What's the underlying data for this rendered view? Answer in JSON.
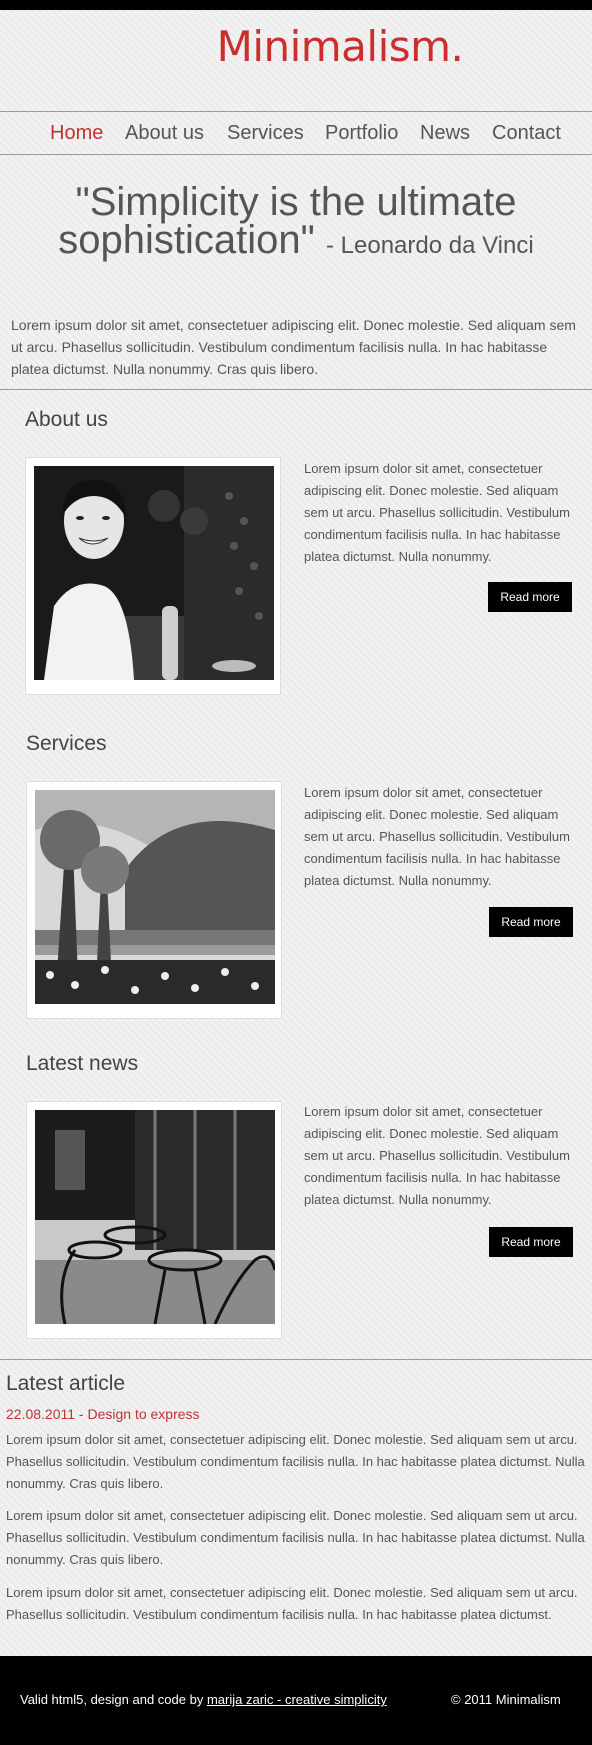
{
  "site": {
    "logo": "Minimalism."
  },
  "nav": [
    "Home",
    "About us",
    "Services",
    "Portfolio",
    "News",
    "Contact"
  ],
  "hero": {
    "quote": "\"Simplicity is the ultimate sophistication\"",
    "author": "- Leonardo da Vinci"
  },
  "intro": "Lorem ipsum dolor sit amet, consectetuer adipiscing elit. Donec molestie. Sed aliquam sem ut arcu. Phasellus sollicitudin. Vestibulum condimentum facilisis nulla. In hac habitasse platea dictumst. Nulla nonummy. Cras quis libero.",
  "sections": [
    {
      "title": "About us",
      "text": "Lorem ipsum dolor sit amet, consectetuer adipiscing elit. Donec molestie. Sed aliquam sem ut arcu. Phasellus sollicitudin. Vestibulum condimentum facilisis nulla. In hac habitasse platea dictumst. Nulla nonummy.",
      "button": "Read more"
    },
    {
      "title": "Services",
      "text": "Lorem ipsum dolor sit amet, consectetuer adipiscing elit. Donec molestie. Sed aliquam sem ut arcu. Phasellus sollicitudin. Vestibulum condimentum facilisis nulla. In hac habitasse platea dictumst. Nulla nonummy.",
      "button": "Read more"
    },
    {
      "title": "Latest news",
      "text": "Lorem ipsum dolor sit amet, consectetuer adipiscing elit. Donec molestie. Sed aliquam sem ut arcu. Phasellus sollicitudin. Vestibulum condimentum facilisis nulla. In hac habitasse platea dictumst. Nulla nonummy.",
      "button": "Read more"
    }
  ],
  "article": {
    "title": "Latest article",
    "date_line": "22.08.2011 - Design to express",
    "paragraphs": [
      "Lorem ipsum dolor sit amet, consectetuer adipiscing elit. Donec molestie. Sed aliquam sem ut arcu. Phasellus sollicitudin. Vestibulum condimentum facilisis nulla. In hac habitasse platea dictumst. Nulla nonummy. Cras quis libero.",
      "Lorem ipsum dolor sit amet, consectetuer adipiscing elit. Donec molestie. Sed aliquam sem ut arcu. Phasellus sollicitudin. Vestibulum condimentum facilisis nulla. In hac habitasse platea dictumst. Nulla nonummy. Cras quis libero.",
      "Lorem ipsum dolor sit amet, consectetuer adipiscing elit. Donec molestie. Sed aliquam sem ut arcu. Phasellus sollicitudin. Vestibulum condimentum facilisis nulla. In hac habitasse platea dictumst."
    ]
  },
  "footer": {
    "credit_prefix": "Valid html5, design and code by",
    "credit_link": "marija zaric - creative simplicity",
    "copyright": "© 2011 Minimalism"
  },
  "colors": {
    "accent": "#c23131",
    "logo": "#cc2d2d",
    "button_bg": "#000000",
    "footer_bg": "#000000"
  }
}
